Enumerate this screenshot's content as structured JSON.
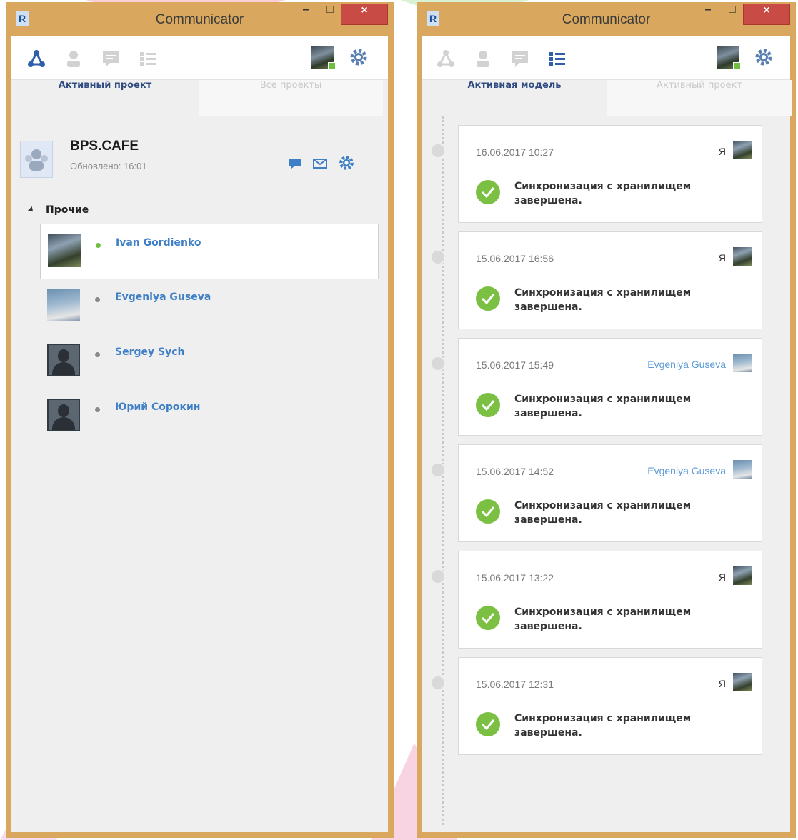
{
  "left_window": {
    "title": "Communicator",
    "logo": "R",
    "controls": {
      "minimize": "–",
      "maximize": "□",
      "close": "×"
    },
    "tabs": [
      {
        "label": "Активный проект",
        "active": true
      },
      {
        "label": "Все проекты",
        "active": false
      }
    ],
    "project": {
      "name": "BPS.CAFE",
      "updated": "Обновлено: 16:01"
    },
    "group": {
      "label": "Прочие"
    },
    "contacts": [
      {
        "name": "Ivan Gordienko",
        "online": true
      },
      {
        "name": "Evgeniya Guseva",
        "online": false
      },
      {
        "name": "Sergey Sych",
        "online": false
      },
      {
        "name": "Юрий Сорокин",
        "online": false
      }
    ]
  },
  "right_window": {
    "title": "Communicator",
    "logo": "R",
    "controls": {
      "minimize": "–",
      "maximize": "□",
      "close": "×"
    },
    "tabs": [
      {
        "label": "Активная модель",
        "active": true
      },
      {
        "label": "Активный проект",
        "active": false
      }
    ],
    "entries": [
      {
        "date": "16.06.2017 10:27",
        "who": "Я",
        "message": "Синхронизация с хранилищем завершена."
      },
      {
        "date": "15.06.2017 16:56",
        "who": "Я",
        "message": "Синхронизация с хранилищем завершена."
      },
      {
        "date": "15.06.2017 15:49",
        "who": "Evgeniya Guseva",
        "message": "Синхронизация с хранилищем завершена."
      },
      {
        "date": "15.06.2017 14:52",
        "who": "Evgeniya Guseva",
        "message": "Синхронизация с хранилищем завершена."
      },
      {
        "date": "15.06.2017 13:22",
        "who": "Я",
        "message": "Синхронизация с хранилищем завершена."
      },
      {
        "date": "15.06.2017 12:31",
        "who": "Я",
        "message": "Синхронизация с хранилищем завершена."
      }
    ]
  },
  "colors": {
    "window_border": "#d9a85e",
    "close_button": "#c84b45",
    "accent_blue": "#3f7fc6",
    "online": "#6ebe3f",
    "success": "#7bc043"
  },
  "icons": [
    "project-graph-icon",
    "contacts-icon",
    "chat-icon",
    "activity-list-icon",
    "settings-gear-icon",
    "message-icon",
    "mail-icon",
    "check-icon"
  ]
}
